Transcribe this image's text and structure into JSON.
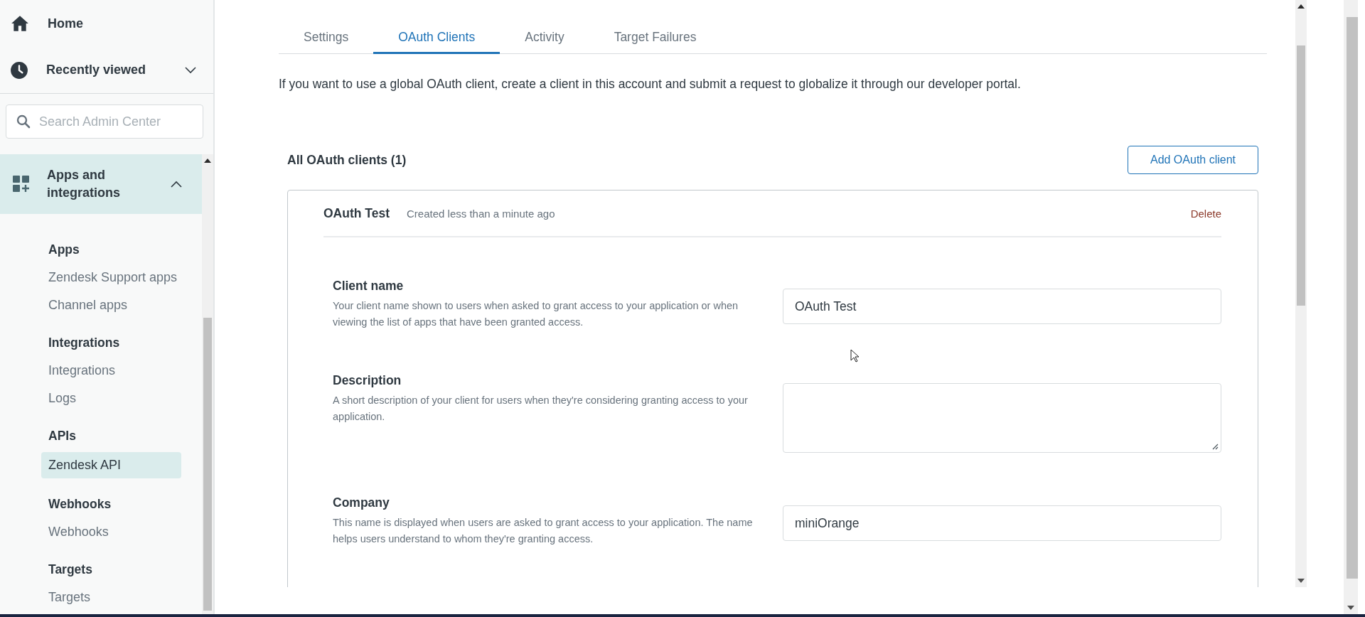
{
  "sidebar": {
    "nav": [
      {
        "label": "Home",
        "kind": "link"
      },
      {
        "label": "Recently viewed",
        "kind": "expander",
        "expanded": false
      }
    ],
    "search": {
      "placeholder": "Search Admin Center"
    },
    "section": {
      "label": "Apps and integrations",
      "expanded": true,
      "groups": [
        {
          "title": "Apps",
          "items": [
            {
              "label": "Zendesk Support apps",
              "selected": false
            },
            {
              "label": "Channel apps",
              "selected": false
            }
          ]
        },
        {
          "title": "Integrations",
          "items": [
            {
              "label": "Integrations",
              "selected": false
            },
            {
              "label": "Logs",
              "selected": false
            }
          ]
        },
        {
          "title": "APIs",
          "items": [
            {
              "label": "Zendesk API",
              "selected": true
            }
          ]
        },
        {
          "title": "Webhooks",
          "items": [
            {
              "label": "Webhooks",
              "selected": false
            }
          ]
        },
        {
          "title": "Targets",
          "items": [
            {
              "label": "Targets",
              "selected": false
            }
          ]
        }
      ]
    }
  },
  "tabs": [
    {
      "label": "Settings",
      "selected": false
    },
    {
      "label": "OAuth Clients",
      "selected": true
    },
    {
      "label": "Activity",
      "selected": false
    },
    {
      "label": "Target Failures",
      "selected": false
    }
  ],
  "intro": "If you want to use a global OAuth client, create a client in this account and submit a request to globalize it through our developer portal.",
  "clients_heading": "All OAuth clients (1)",
  "add_button": "Add OAuth client",
  "client_card": {
    "name": "OAuth Test",
    "created": "Created less than a minute ago",
    "delete": "Delete",
    "fields": [
      {
        "label": "Client name",
        "help": "Your client name shown to users when asked to grant access to your application or when viewing the list of apps that have been granted access.",
        "kind": "text",
        "value": "OAuth Test"
      },
      {
        "label": "Description",
        "help": "A short description of your client for users when they're considering granting access to your application.",
        "kind": "textarea"
      },
      {
        "label": "Company",
        "help": "This name is displayed when users are asked to grant access to your application. The name helps users understand to whom they're granting access.",
        "kind": "text",
        "value": "miniOrange"
      }
    ]
  }
}
